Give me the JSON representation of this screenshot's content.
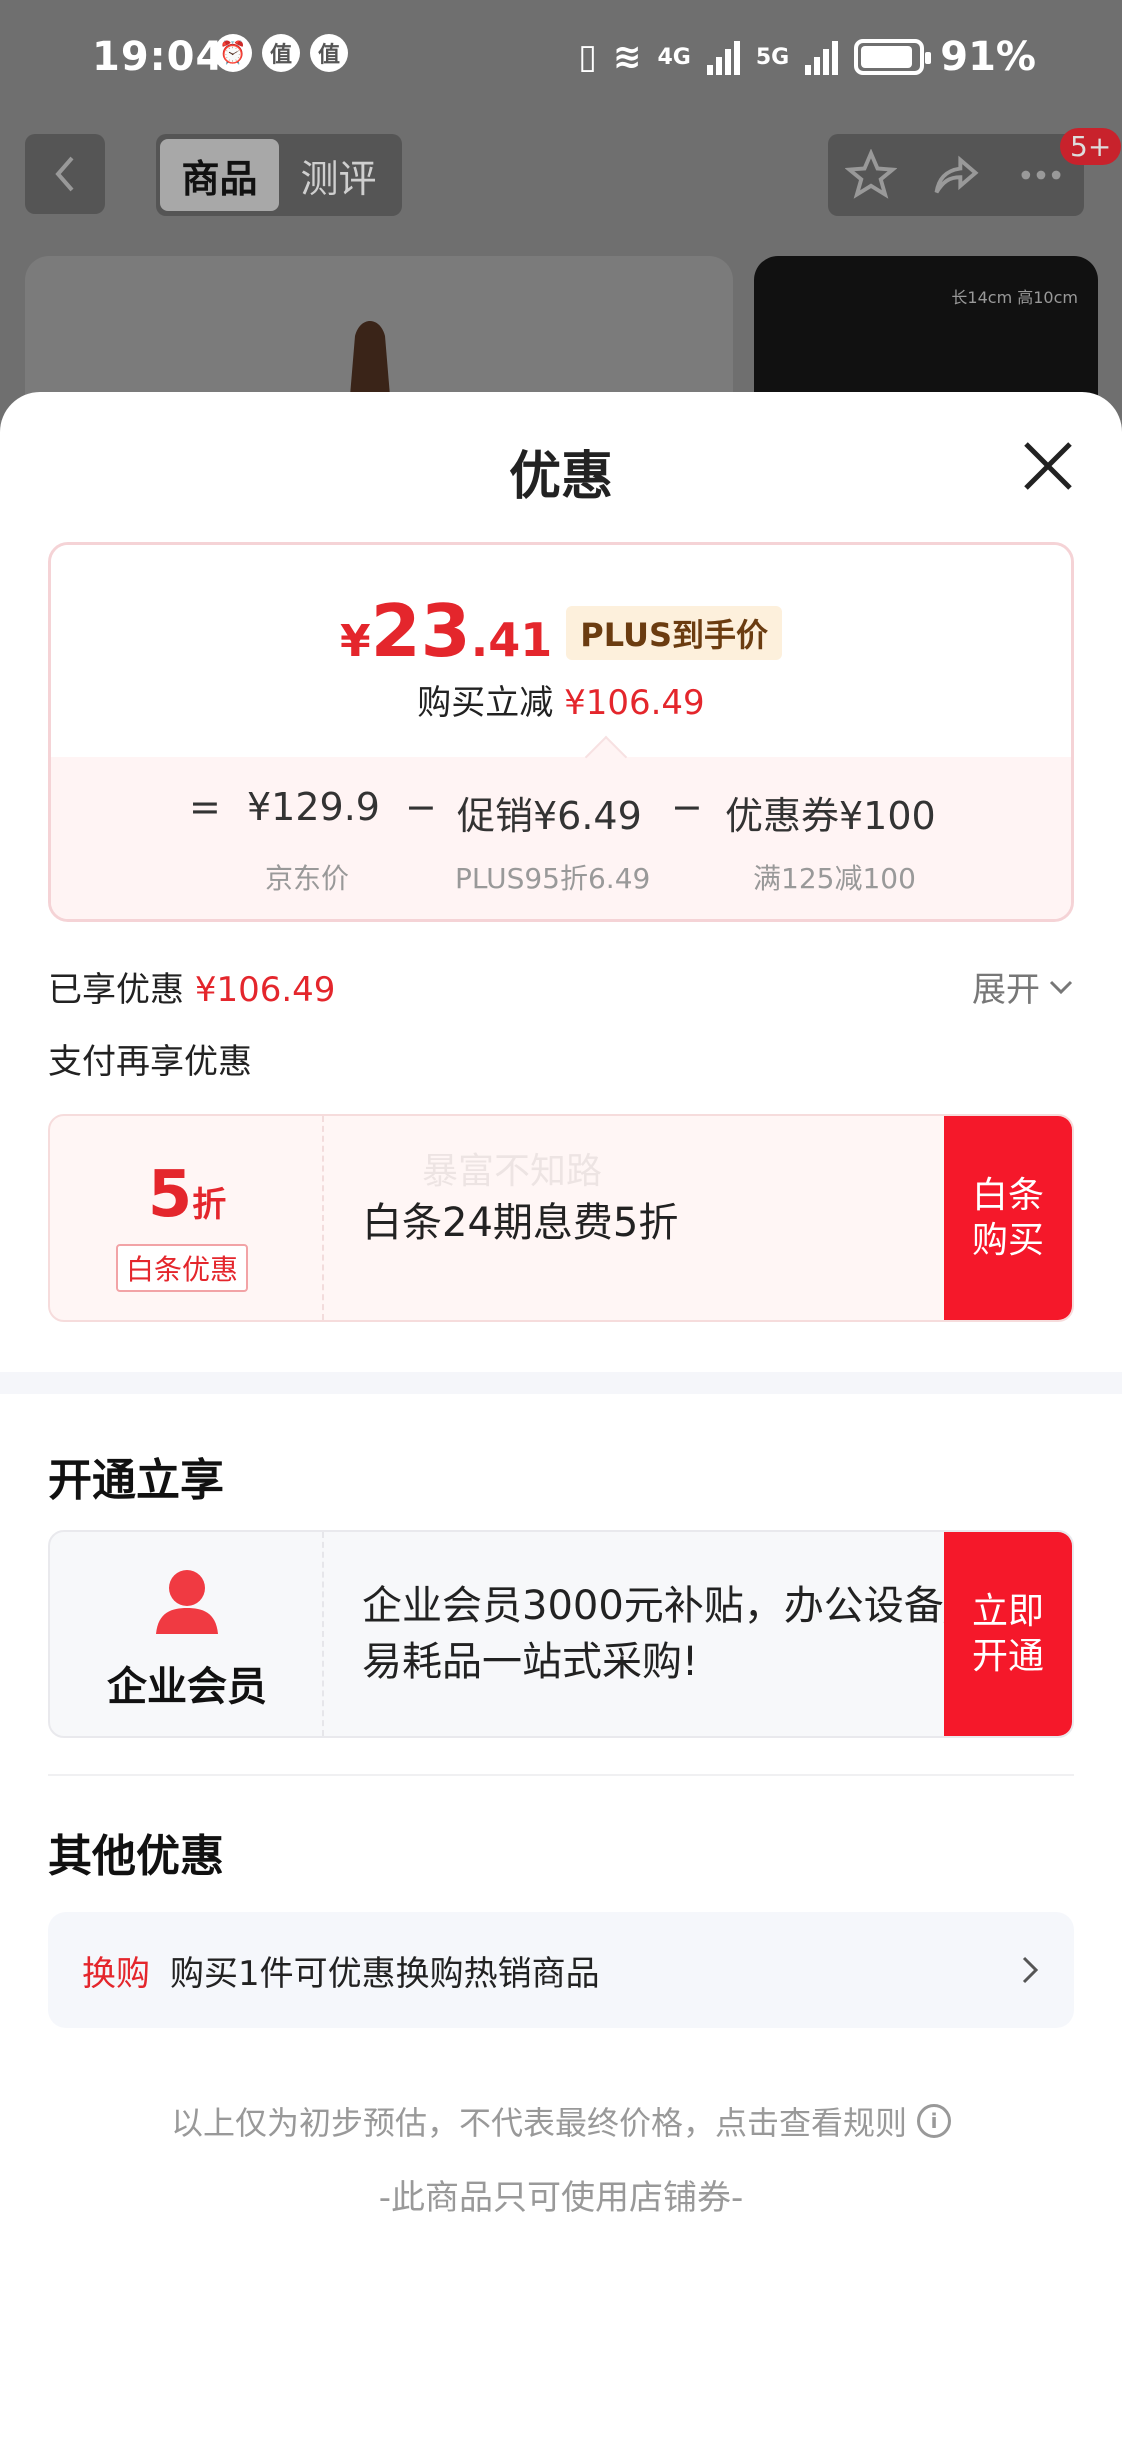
{
  "status_bar": {
    "time": "19:04",
    "notif_icon_1": "值",
    "notif_icon_2": "值",
    "battery": "91%",
    "net1": "4G",
    "net2": "5G"
  },
  "nav": {
    "tabs": [
      {
        "label": "商品"
      },
      {
        "label": "测评"
      }
    ],
    "badge": "5+"
  },
  "thumb_label": "长14cm 高10cm",
  "sheet": {
    "title": "优惠",
    "price": {
      "yen": "¥",
      "int": "23",
      "dec": ".41",
      "tag": "PLUS到手价",
      "reduce_label": "购买立减",
      "reduce_value": "¥106.49"
    },
    "formula": {
      "eq": "=",
      "minus": "−",
      "jd_price": "¥129.9",
      "jd_price_label": "京东价",
      "promo": "促销¥6.49",
      "promo_label": "PLUS95折6.49",
      "coupon": "优惠券¥100",
      "coupon_label": "满125减100"
    },
    "enjoyed_label": "已享优惠",
    "enjoyed_value": "¥106.49",
    "expand_label": "展开",
    "pay_more_label": "支付再享优惠",
    "baitiao": {
      "discount_num": "5",
      "discount_unit": "折",
      "tag": "白条优惠",
      "text": "白条24期息费5折",
      "watermark": "暴富不知路",
      "button": "白条购买"
    },
    "open_section_title": "开通立享",
    "member": {
      "label": "企业会员",
      "text": "企业会员3000元补贴，办公设备/易耗品一站式采购!",
      "button": "立即开通"
    },
    "other_section_title": "其他优惠",
    "swap": {
      "tag": "换购",
      "text": "购买1件可优惠换购热销商品"
    },
    "disclaimer": "以上仅为初步预估，不代表最终价格，点击查看规则",
    "shop_only": "-此商品只可使用店铺券-"
  },
  "colors": {
    "accent_red": "#e4262c",
    "button_red": "#f5182a",
    "plus_tag_bg": "#fdf0dc"
  }
}
